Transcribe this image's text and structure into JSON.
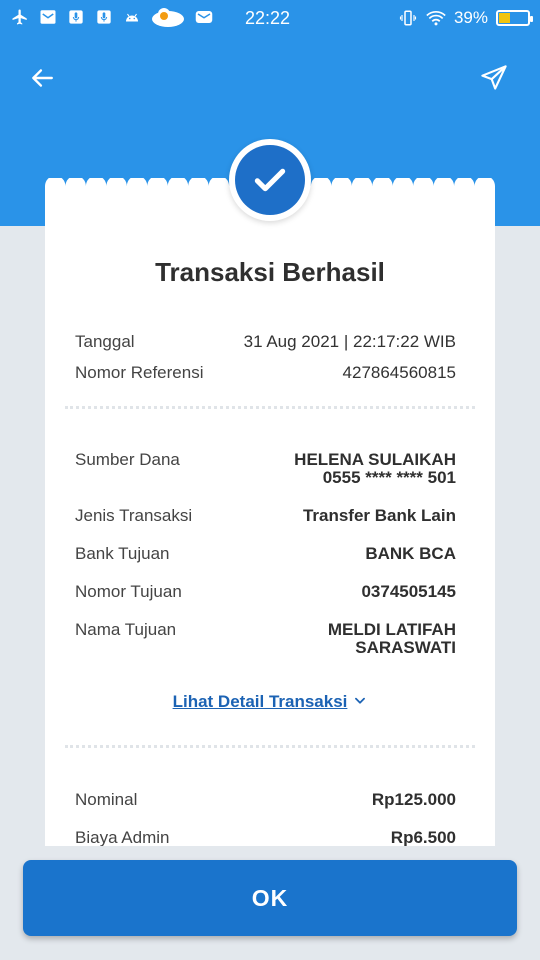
{
  "status_bar": {
    "time": "22:22",
    "battery": "39%",
    "battery_level": 0.39,
    "left_icons": [
      "airplane-icon",
      "mail-icon",
      "mic-icon",
      "mic-icon",
      "android-icon",
      "cloud-icon",
      "email-icon"
    ],
    "right_icons": [
      "vibrate-icon",
      "wifi-icon",
      "battery-icon"
    ]
  },
  "header": {
    "back_icon": "arrow-left-icon",
    "share_icon": "send-icon"
  },
  "receipt": {
    "title": "Transaksi Berhasil",
    "info": [
      {
        "label": "Tanggal",
        "value": "31 Aug 2021 | 22:17:22 WIB"
      },
      {
        "label": "Nomor Referensi",
        "value": "427864560815"
      }
    ],
    "details": {
      "sumber_dana_label": "Sumber Dana",
      "sumber_dana_name": "HELENA SULAIKAH",
      "sumber_dana_account": "0555 **** **** 501",
      "jenis_label": "Jenis Transaksi",
      "jenis_value": "Transfer Bank Lain",
      "bank_label": "Bank Tujuan",
      "bank_value": "BANK BCA",
      "nomor_label": "Nomor Tujuan",
      "nomor_value": "0374505145",
      "nama_label": "Nama Tujuan",
      "nama_line1": "MELDI LATIFAH",
      "nama_line2": "SARASWATI"
    },
    "detail_link": "Lihat Detail Transaksi",
    "amounts": [
      {
        "label": "Nominal",
        "value": "Rp125.000"
      },
      {
        "label": "Biaya Admin",
        "value": "Rp6.500"
      }
    ]
  },
  "ok_button": "OK",
  "colors": {
    "primary_blue": "#2a93e8",
    "button_blue": "#1a74cc",
    "link_blue": "#1c63b4",
    "background": "#e3e8ed"
  }
}
